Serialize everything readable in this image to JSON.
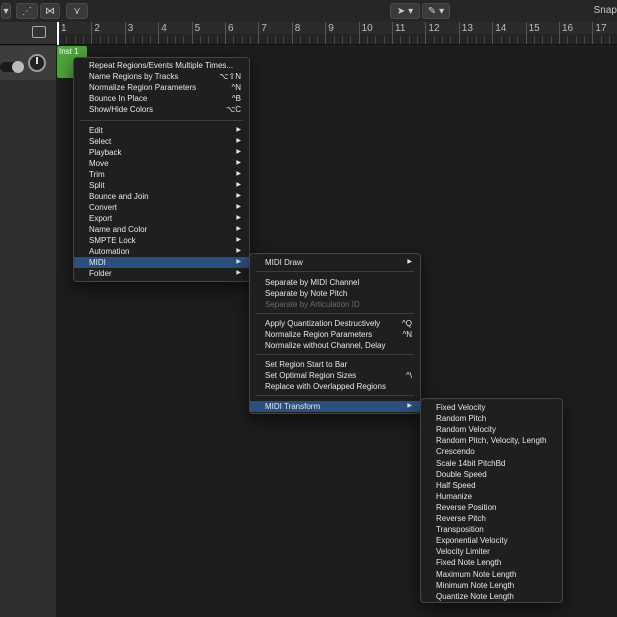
{
  "toolbar": {
    "snap_label": "Snap"
  },
  "track": {
    "region_name": "Inst 1"
  },
  "ruler": {
    "bars": [
      "1",
      "2",
      "3",
      "4",
      "5",
      "6",
      "7",
      "8",
      "9",
      "10",
      "11",
      "12",
      "13",
      "14",
      "15",
      "16",
      "17"
    ]
  },
  "context_menu": {
    "group1": [
      {
        "label": "Repeat Regions/Events Multiple Times...",
        "shortcut": ""
      },
      {
        "label": "Name Regions by Tracks",
        "shortcut": "⌥⇧N"
      },
      {
        "label": "Normalize Region Parameters",
        "shortcut": "^N"
      },
      {
        "label": "Bounce In Place",
        "shortcut": "^B"
      },
      {
        "label": "Show/Hide Colors",
        "shortcut": "⌥C"
      }
    ],
    "group2": [
      {
        "label": "Edit"
      },
      {
        "label": "Select"
      },
      {
        "label": "Playback"
      },
      {
        "label": "Move"
      },
      {
        "label": "Trim"
      },
      {
        "label": "Split"
      },
      {
        "label": "Bounce and Join"
      },
      {
        "label": "Convert"
      },
      {
        "label": "Export"
      },
      {
        "label": "Name and Color"
      },
      {
        "label": "SMPTE Lock"
      },
      {
        "label": "Automation"
      },
      {
        "label": "MIDI"
      },
      {
        "label": "Folder"
      }
    ]
  },
  "midi_submenu": {
    "midi_draw": "MIDI Draw",
    "group_separate": [
      {
        "label": "Separate by MIDI Channel",
        "disabled": false
      },
      {
        "label": "Separate by Note Pitch",
        "disabled": false
      },
      {
        "label": "Separate by Articulation ID",
        "disabled": true
      }
    ],
    "group_quant": [
      {
        "label": "Apply Quantization Destructively",
        "shortcut": "^Q"
      },
      {
        "label": "Normalize Region Parameters",
        "shortcut": "^N"
      },
      {
        "label": "Normalize without Channel, Delay",
        "shortcut": ""
      }
    ],
    "group_region": [
      {
        "label": "Set Region Start to Bar",
        "shortcut": ""
      },
      {
        "label": "Set Optimal Region Sizes",
        "shortcut": "^\\"
      },
      {
        "label": "Replace with Overlapped Regions",
        "shortcut": ""
      }
    ],
    "midi_transform": "MIDI Transform"
  },
  "transform_submenu": [
    "Fixed Velocity",
    "Random Pitch",
    "Random Velocity",
    "Random Pitch, Velocity, Length",
    "Crescendo",
    "Scale 14bit PitchBd",
    "Double Speed",
    "Half Speed",
    "Humanize",
    "Reverse Position",
    "Reverse Pitch",
    "Transposition",
    "Exponential Velocity",
    "Velocity Limiter",
    "Fixed Note Length",
    "Maximum Note Length",
    "Minimum Note Length",
    "Quantize Note Length"
  ],
  "colors": {
    "highlight": "#2d4f7e",
    "region": "#4fa53b"
  }
}
